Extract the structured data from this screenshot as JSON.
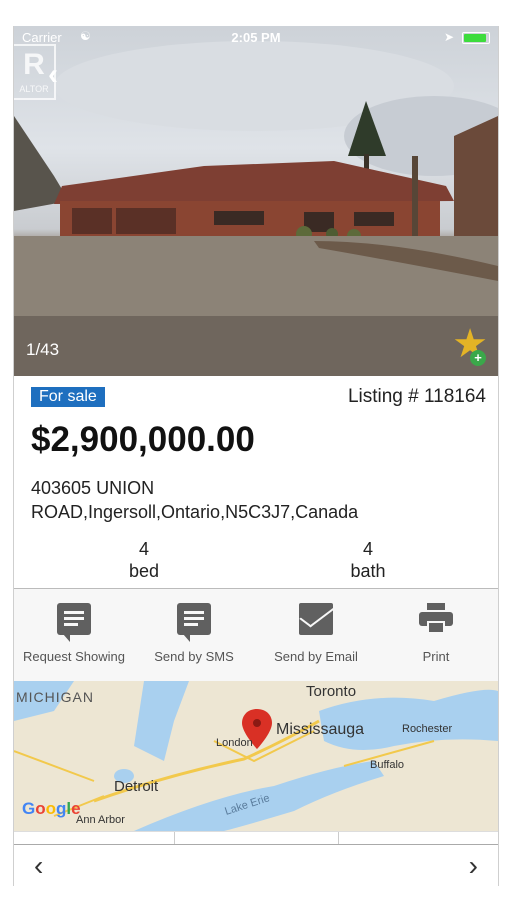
{
  "status_bar": {
    "carrier": "Carrier",
    "time": "2:05 PM"
  },
  "photo": {
    "counter": "1/43"
  },
  "listing": {
    "status_badge": "For sale",
    "listing_number": "Listing # 118164",
    "price": "$2,900,000.00",
    "address_line1": "403605 UNION",
    "address_line2": "ROAD,Ingersoll,Ontario,N5C3J7,Canada",
    "beds": {
      "value": "4",
      "label": "bed"
    },
    "baths": {
      "value": "4",
      "label": "bath"
    }
  },
  "actions": [
    {
      "label": "Request Showing",
      "icon": "chat-icon"
    },
    {
      "label": "Send by SMS",
      "icon": "chat-icon"
    },
    {
      "label": "Send by Email",
      "icon": "mail-icon"
    },
    {
      "label": "Print",
      "icon": "print-icon"
    }
  ],
  "map": {
    "labels": {
      "michigan": "MICHIGAN",
      "toronto": "Toronto",
      "mississauga": "Mississauga",
      "rochester": "Rochester",
      "london": "London",
      "detroit": "Detroit",
      "buffalo": "Buffalo",
      "ann_arbor": "Ann Arbor",
      "lake_erie": "Lake Erie"
    },
    "google": "Google"
  },
  "colors": {
    "badge": "#1e6fbf",
    "star": "#e3b326"
  }
}
